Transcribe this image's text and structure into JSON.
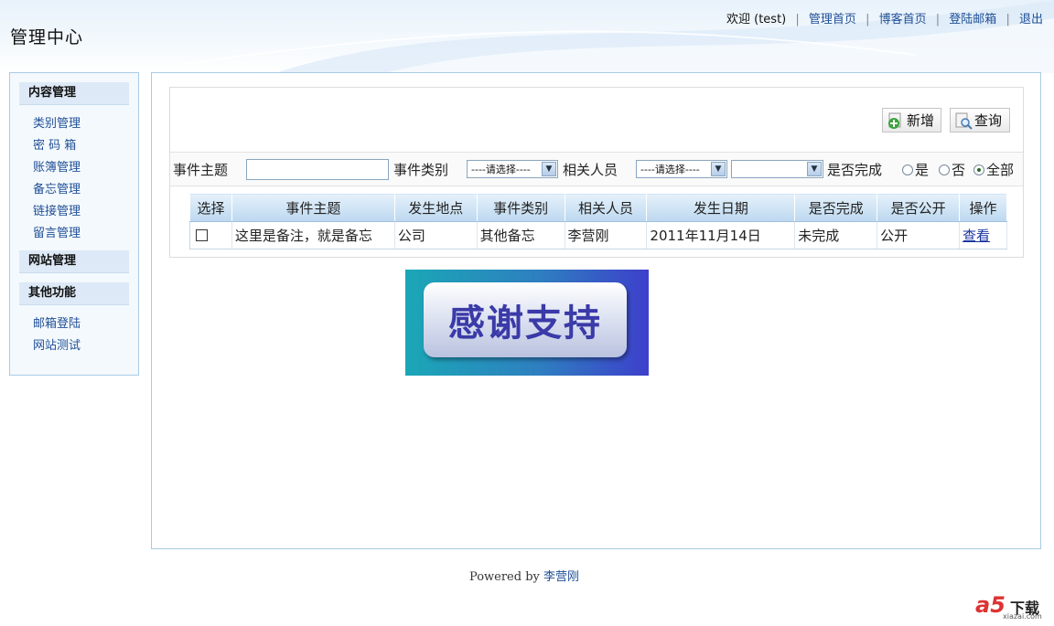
{
  "header": {
    "title": "管理中心",
    "welcome": "欢迎 (test)",
    "links": [
      "管理首页",
      "博客首页",
      "登陆邮箱",
      "退出"
    ]
  },
  "sidebar": {
    "sections": [
      {
        "title": "内容管理",
        "items": [
          "类别管理",
          "密 码 箱",
          "账簿管理",
          "备忘管理",
          "链接管理",
          "留言管理"
        ]
      },
      {
        "title": "网站管理",
        "items": []
      },
      {
        "title": "其他功能",
        "items": [
          "邮箱登陆",
          "网站测试"
        ]
      }
    ]
  },
  "toolbar": {
    "add_label": "新增",
    "query_label": "查询"
  },
  "filter": {
    "subject_label": "事件主题",
    "subject_value": "",
    "category_label": "事件类别",
    "category_select": "----请选择----",
    "person_label": "相关人员",
    "person_select": "----请选择----",
    "extra_select": "",
    "done_label": "是否完成",
    "radio_options": [
      "是",
      "否",
      "全部"
    ],
    "radio_selected": "全部"
  },
  "table": {
    "columns": [
      "选择",
      "事件主题",
      "发生地点",
      "事件类别",
      "相关人员",
      "发生日期",
      "是否完成",
      "是否公开",
      "操作"
    ],
    "rows": [
      {
        "subject": "这里是备注，就是备忘",
        "place": "公司",
        "category": "其他备忘",
        "person": "李营刚",
        "date": "2011年11月14日",
        "done": "未完成",
        "public": "公开",
        "action": "查看"
      }
    ]
  },
  "banner": {
    "text": "感谢支持"
  },
  "footer": {
    "powered": "Powered by",
    "author": "李营刚"
  },
  "watermark": {
    "brand": "a5",
    "label": "下载",
    "domain": "xiazai.com"
  },
  "colors": {
    "link": "#1f4f96",
    "border": "#a9cbe4",
    "sidebar_head": "#dde9f6"
  }
}
